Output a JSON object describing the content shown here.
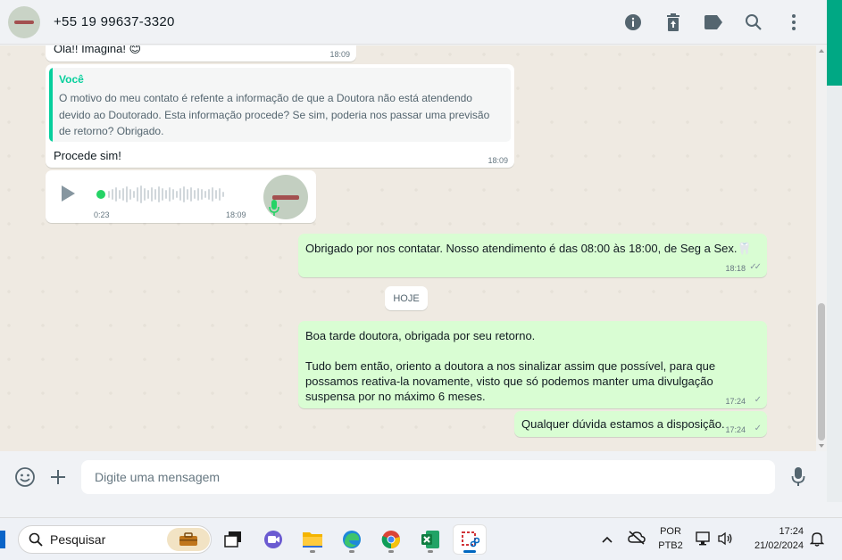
{
  "header": {
    "contact": "+55 19 99637-3320",
    "icons": [
      "info-icon",
      "delete-icon",
      "label-icon",
      "search-icon",
      "menu-icon"
    ]
  },
  "messages": {
    "m1": {
      "text": "Olá!! Imagina! 😊",
      "time": "18:09"
    },
    "m2": {
      "quote_author": "Você",
      "quote_text": "O motivo do meu contato é refente a informação de que a Doutora não está atendendo devido ao Doutorado. Esta informação procede? Se sim, poderia nos passar uma previsão de retorno? Obrigado.",
      "text": "Procede sim!",
      "time": "18:09"
    },
    "audio": {
      "duration": "0:23",
      "time": "18:09"
    },
    "m3": {
      "text": "Obrigado por nos contatar. Nosso atendimento é das 08:00 às 18:00, de Seg a Sex.🦷",
      "time": "18:18"
    },
    "date_chip": "HOJE",
    "m4": {
      "text": "Boa tarde doutora, obrigada por seu retorno.\n\nTudo bem então, oriento a doutora a nos sinalizar assim que possível, para que possamos reativa-la novamente, visto que só podemos manter uma divulgação suspensa por no máximo 6 meses.",
      "time": "17:24"
    },
    "m5": {
      "text": "Qualquer dúvida estamos a disposição.",
      "time": "17:24"
    }
  },
  "composer": {
    "placeholder": "Digite uma mensagem"
  },
  "taskbar": {
    "search_label": "Pesquisar",
    "lang_top": "POR",
    "lang_bottom": "PTB2",
    "clock_time": "17:24",
    "clock_date": "21/02/2024"
  },
  "colors": {
    "accent": "#00a884",
    "outgoing_bubble": "#d9fdd3",
    "incoming_bubble": "#ffffff",
    "chat_bg": "#efeae2"
  }
}
